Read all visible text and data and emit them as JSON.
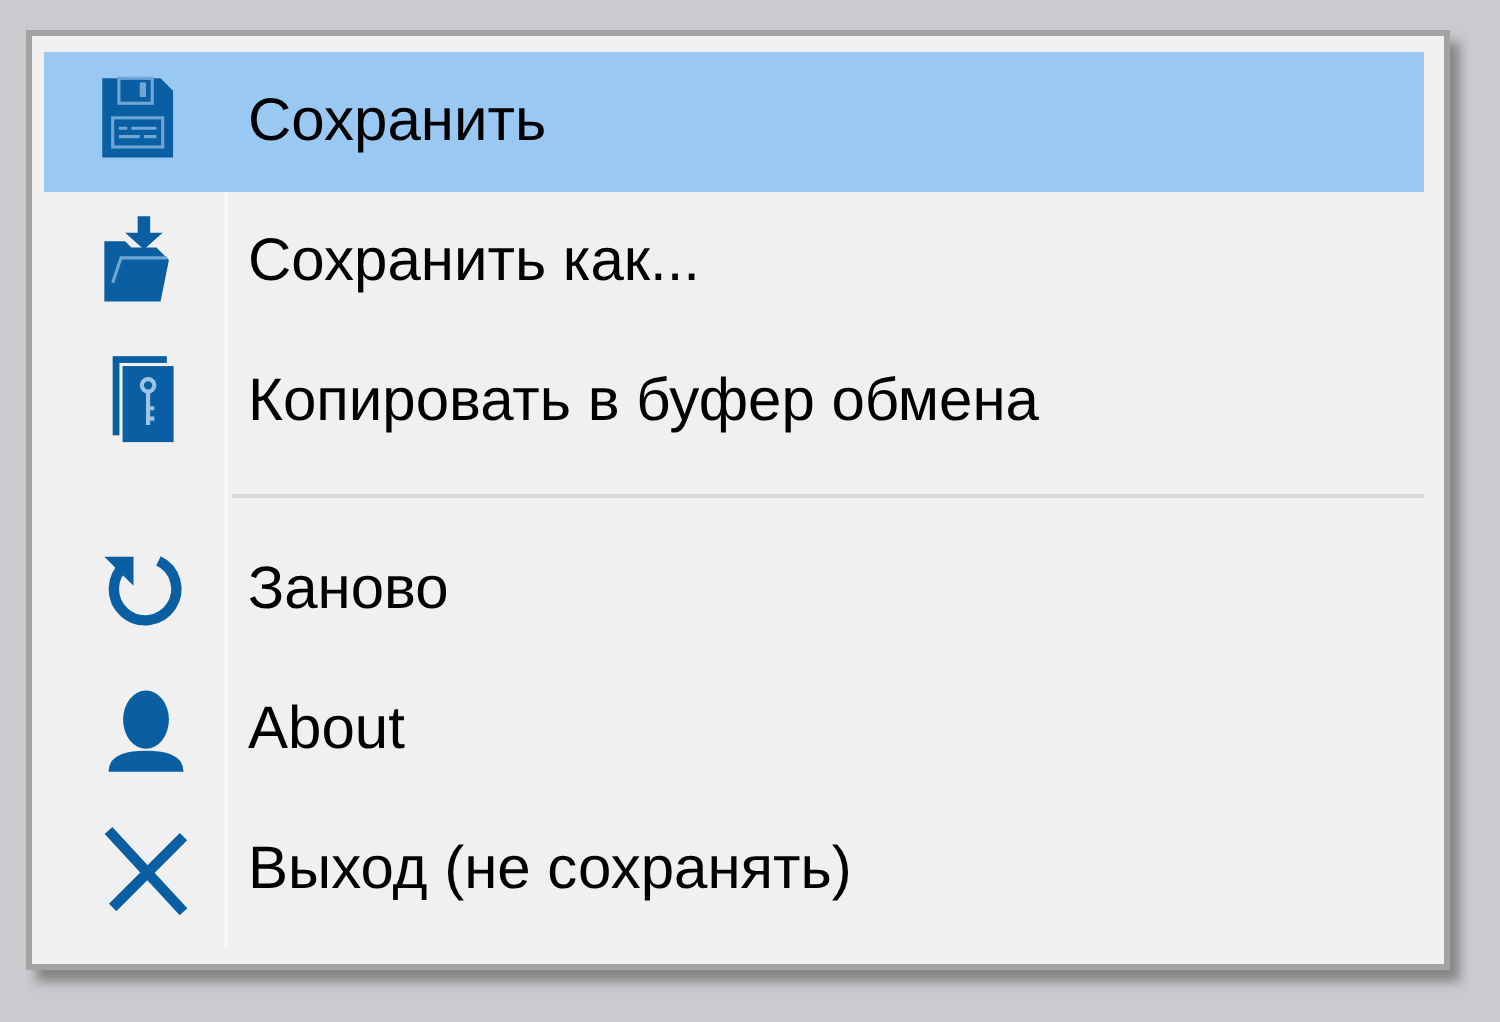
{
  "menu": {
    "items": [
      {
        "kind": "item",
        "label": "Сохранить",
        "selected": true
      },
      {
        "kind": "item",
        "label": "Сохранить как...",
        "selected": false
      },
      {
        "kind": "item",
        "label": "Копировать в буфер обмена",
        "selected": false
      },
      {
        "kind": "separator"
      },
      {
        "kind": "item",
        "label": "Заново",
        "selected": false
      },
      {
        "kind": "item",
        "label": "About",
        "selected": false
      },
      {
        "kind": "item",
        "label": "Выход (не сохранять)",
        "selected": false
      }
    ]
  }
}
